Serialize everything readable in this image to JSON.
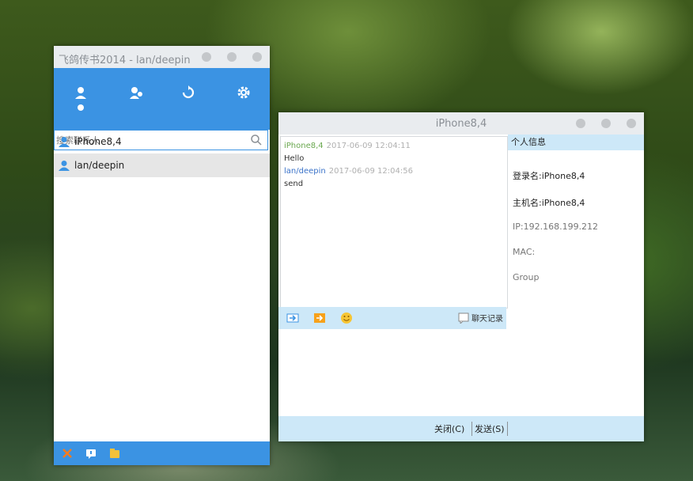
{
  "main_window": {
    "title": "飞鸽传书2014 - lan/deepin",
    "search": {
      "placeholder": "搜索联系人"
    },
    "contacts": [
      {
        "name": "iPhone8,4",
        "selected": false
      },
      {
        "name": "lan/deepin",
        "selected": true
      }
    ],
    "accent": "#3b93e3"
  },
  "chat_window": {
    "title": "iPhone8,4",
    "messages": [
      {
        "sender": "iPhone8,4",
        "time": "2017-06-09 12:04:11",
        "text": "Hello"
      },
      {
        "sender": "lan/deepin",
        "time": "2017-06-09 12:04:56",
        "text": "send"
      }
    ],
    "history_label": "聊天记录",
    "info_panel": {
      "header": "个人信息",
      "login_name": "登录名:iPhone8,4",
      "host_name": "主机名:iPhone8,4",
      "ip": "IP:192.168.199.212",
      "mac": "MAC:",
      "group": "Group"
    },
    "close_button": "关闭(C)",
    "send_button": "发送(S)",
    "panel_color": "#cde8f8"
  }
}
